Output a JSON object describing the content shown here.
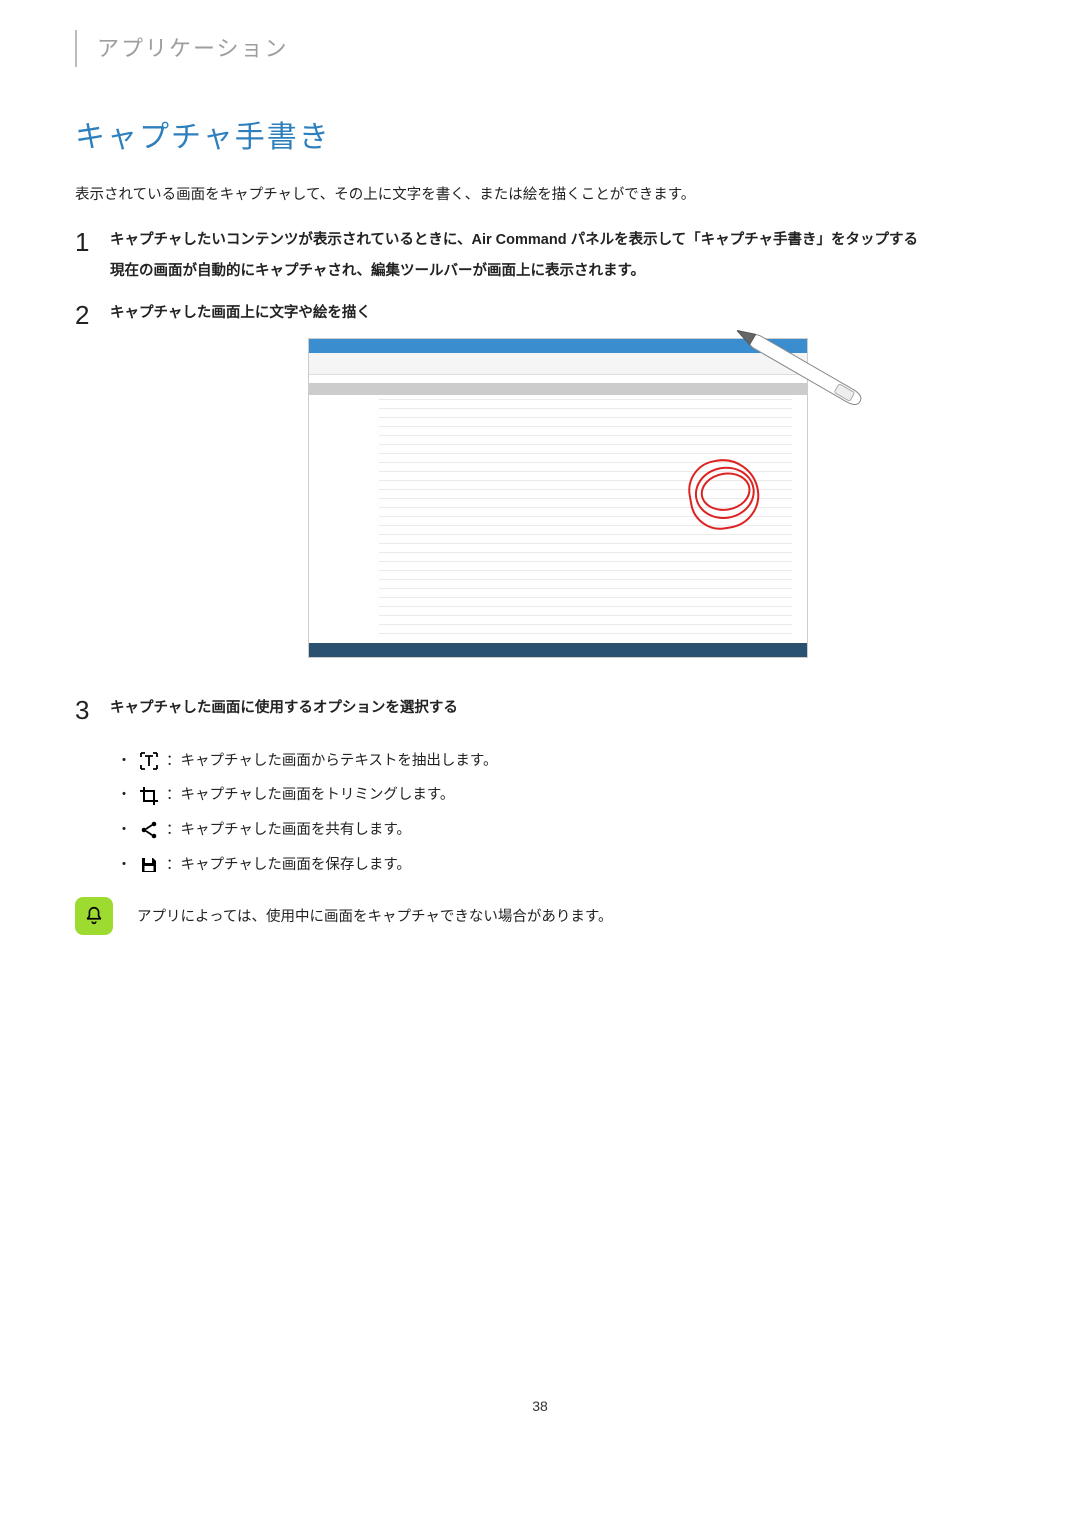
{
  "breadcrumb": "アプリケーション",
  "title": "キャプチャ手書き",
  "intro": "表示されている画面をキャプチャして、その上に文字を書く、または絵を描くことができます。",
  "steps": {
    "s1": {
      "num": "1",
      "title": "キャプチャしたいコンテンツが表示されているときに、Air Command パネルを表示して「キャプチャ手書き」をタップする",
      "sub": "現在の画面が自動的にキャプチャされ、編集ツールバーが画面上に表示されます。"
    },
    "s2": {
      "num": "2",
      "title": "キャプチャした画面上に文字や絵を描く"
    },
    "s3": {
      "num": "3",
      "title": "キャプチャした画面に使用するオプションを選択する"
    }
  },
  "options": {
    "o1": "：キャプチャした画面からテキストを抽出します。",
    "o2": "：キャプチャした画面をトリミングします。",
    "o3": "：キャプチャした画面を共有します。",
    "o4": "：キャプチャした画面を保存します。"
  },
  "note": "アプリによっては、使用中に画面をキャプチャできない場合があります。",
  "page_num": "38"
}
